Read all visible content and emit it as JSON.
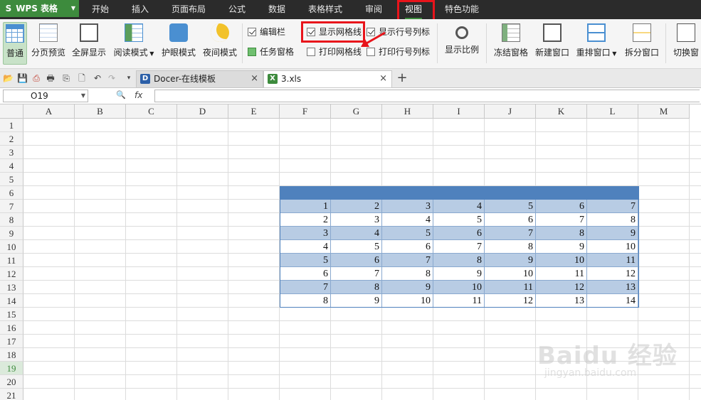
{
  "menubar": {
    "app_logo": "S",
    "app_name": "WPS 表格",
    "items": [
      {
        "label": "开始"
      },
      {
        "label": "插入"
      },
      {
        "label": "页面布局"
      },
      {
        "label": "公式"
      },
      {
        "label": "数据"
      },
      {
        "label": "表格样式"
      },
      {
        "label": "审阅"
      },
      {
        "label": "视图",
        "active": true
      },
      {
        "label": "特色功能"
      }
    ]
  },
  "ribbon": {
    "buttons": [
      {
        "label": "普通",
        "icon": "normal-view-icon",
        "selected": true
      },
      {
        "label": "分页预览",
        "icon": "page-break-preview-icon"
      },
      {
        "label": "全屏显示",
        "icon": "fullscreen-icon"
      },
      {
        "label": "阅读模式",
        "icon": "reading-mode-icon",
        "has_dropdown": true
      },
      {
        "label": "护眼模式",
        "icon": "eye-care-icon"
      },
      {
        "label": "夜间模式",
        "icon": "night-mode-icon"
      },
      {
        "label": "显示比例",
        "icon": "zoom-icon"
      },
      {
        "label": "冻结窗格",
        "icon": "freeze-panes-icon"
      },
      {
        "label": "新建窗口",
        "icon": "new-window-icon"
      },
      {
        "label": "重排窗口",
        "icon": "arrange-window-icon",
        "has_dropdown": true
      },
      {
        "label": "拆分窗口",
        "icon": "split-window-icon"
      },
      {
        "label": "切换窗",
        "icon": "switch-window-icon"
      }
    ],
    "checkboxes": [
      {
        "label": "编辑栏",
        "checked": true
      },
      {
        "label": "任务窗格",
        "checked": true
      },
      {
        "label": "显示网格线",
        "checked": true
      },
      {
        "label": "打印网格线",
        "checked": false
      },
      {
        "label": "显示行号列标",
        "checked": true
      },
      {
        "label": "打印行号列标",
        "checked": false
      }
    ]
  },
  "quick_access": {
    "icons": [
      "open-folder-icon",
      "save-icon",
      "export-pdf-icon",
      "print-icon",
      "print-preview-icon",
      "preview-icon",
      "undo-icon",
      "redo-icon",
      "more-icon"
    ],
    "glyphs": [
      "📂",
      "💾",
      "⎙",
      "🖶",
      "⎘",
      "🗋",
      "↶",
      "↷",
      "▾"
    ]
  },
  "tabs": [
    {
      "label": "Docer-在线模板",
      "icon": "D",
      "close": "×"
    },
    {
      "label": "3.xls",
      "icon": "X",
      "close": "×",
      "active": true
    }
  ],
  "new_tab_label": "+",
  "formula_bar": {
    "cell_ref": "O19",
    "zoom_glyph": "🔍",
    "fx_label": "fx",
    "formula_value": ""
  },
  "sheet": {
    "columns": [
      "A",
      "B",
      "C",
      "D",
      "E",
      "F",
      "G",
      "H",
      "I",
      "J",
      "K",
      "L",
      "M"
    ],
    "rows": [
      "1",
      "2",
      "3",
      "4",
      "5",
      "6",
      "7",
      "8",
      "9",
      "10",
      "11",
      "12",
      "13",
      "14",
      "15",
      "16",
      "17",
      "18",
      "19",
      "20",
      "21"
    ],
    "selected_row": "19",
    "table_rows": [
      [
        1,
        2,
        3,
        4,
        5,
        6,
        7
      ],
      [
        2,
        3,
        4,
        5,
        6,
        7,
        8
      ],
      [
        3,
        4,
        5,
        6,
        7,
        8,
        9
      ],
      [
        4,
        5,
        6,
        7,
        8,
        9,
        10
      ],
      [
        5,
        6,
        7,
        8,
        9,
        10,
        11
      ],
      [
        6,
        7,
        8,
        9,
        10,
        11,
        12
      ],
      [
        7,
        8,
        9,
        10,
        11,
        12,
        13
      ],
      [
        8,
        9,
        10,
        11,
        12,
        13,
        14
      ]
    ],
    "header_color": "#4f81bd",
    "band_color": "#b8cce4"
  },
  "watermark": {
    "main": "Baidu 经验",
    "sub": "jingyan.baidu.com"
  },
  "colors": {
    "accent_green": "#3d8b3d",
    "annotation_red": "#e8141b"
  }
}
